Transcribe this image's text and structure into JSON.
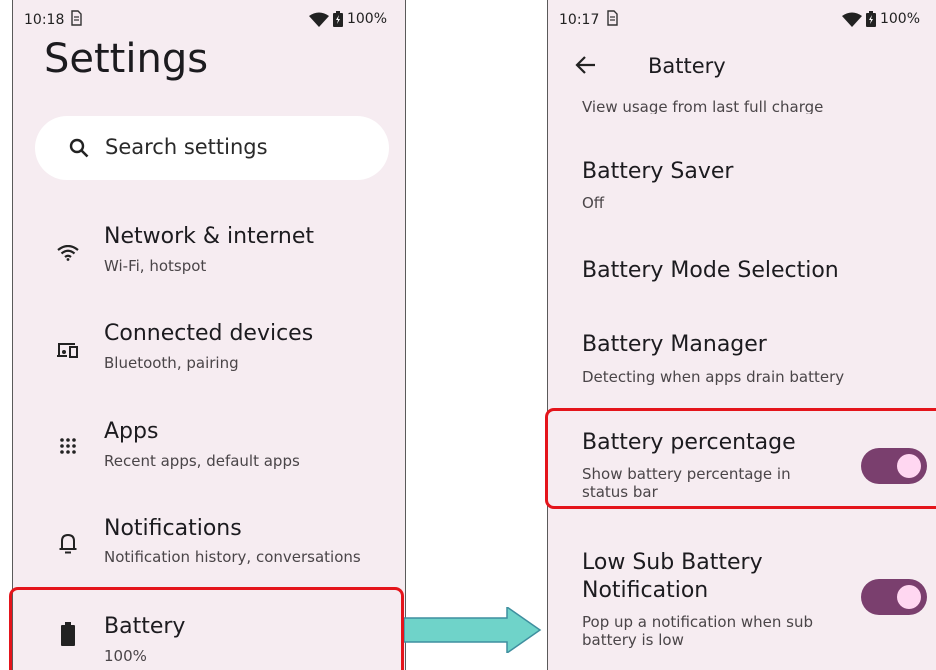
{
  "left": {
    "status": {
      "time": "10:18",
      "battery": "100%"
    },
    "title": "Settings",
    "search": {
      "placeholder": "Search settings"
    },
    "items": [
      {
        "title": "Network & internet",
        "subtitle": "Wi-Fi, hotspot",
        "icon": "wifi-icon"
      },
      {
        "title": "Connected devices",
        "subtitle": "Bluetooth, pairing",
        "icon": "devices-icon"
      },
      {
        "title": "Apps",
        "subtitle": "Recent apps, default apps",
        "icon": "apps-grid-icon"
      },
      {
        "title": "Notifications",
        "subtitle": "Notification history, conversations",
        "icon": "bell-icon"
      },
      {
        "title": "Battery",
        "subtitle": "100%",
        "icon": "battery-icon"
      }
    ]
  },
  "right": {
    "status": {
      "time": "10:17",
      "battery": "100%"
    },
    "page_title": "Battery",
    "partial_text": "View usage from last full charge",
    "items": [
      {
        "title": "Battery Saver",
        "subtitle": "Off"
      },
      {
        "title": "Battery Mode Selection"
      },
      {
        "title": "Battery Manager",
        "subtitle": "Detecting when apps drain battery"
      },
      {
        "title": "Battery percentage",
        "subtitle_lines": [
          "Show battery percentage in",
          "status bar"
        ],
        "toggle_on": true
      },
      {
        "title_lines": [
          "Low Sub Battery",
          "Notification"
        ],
        "subtitle_lines": [
          "Pop up a notification when sub",
          "battery is low"
        ],
        "toggle_on": true
      }
    ]
  },
  "colors": {
    "background": "#f6ecf1",
    "toggle_track": "#7a3f6e",
    "toggle_knob": "#ffd7f1",
    "highlight": "#e4141b",
    "arrow": "#6fd3c9"
  }
}
